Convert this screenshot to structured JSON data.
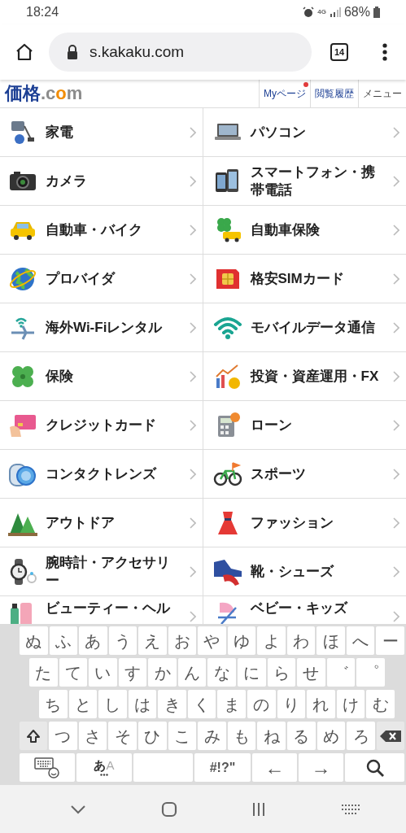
{
  "status_bar": {
    "time": "18:24",
    "network": "4G",
    "battery": "68%"
  },
  "browser": {
    "url": "s.kakaku.com",
    "tab_count": "14"
  },
  "site_header": {
    "logo": [
      {
        "text": "価格",
        "color": "#1c3f94"
      },
      {
        "text": ".c",
        "color": "#8c8c8c"
      },
      {
        "text": "o",
        "color": "#f28c00"
      },
      {
        "text": "m",
        "color": "#8c8c8c"
      }
    ],
    "links": [
      {
        "label": "Myページ",
        "badge": true
      },
      {
        "label": "閲覧履歴",
        "badge": false
      },
      {
        "label": "メニュー",
        "badge": false
      }
    ]
  },
  "category_rows": [
    [
      {
        "label": "家電"
      },
      {
        "label": "パソコン"
      }
    ],
    [
      {
        "label": "カメラ"
      },
      {
        "label": "スマートフォン・携帯電話"
      }
    ],
    [
      {
        "label": "自動車・バイク"
      },
      {
        "label": "自動車保険"
      }
    ],
    [
      {
        "label": "プロバイダ"
      },
      {
        "label": "格安SIMカード"
      }
    ],
    [
      {
        "label": "海外Wi-Fiレンタル"
      },
      {
        "label": "モバイルデータ通信"
      }
    ],
    [
      {
        "label": "保険"
      },
      {
        "label": "投資・資産運用・FX"
      }
    ],
    [
      {
        "label": "クレジットカード"
      },
      {
        "label": "ローン"
      }
    ],
    [
      {
        "label": "コンタクトレンズ"
      },
      {
        "label": "スポーツ"
      }
    ],
    [
      {
        "label": "アウトドア"
      },
      {
        "label": "ファッション"
      }
    ],
    [
      {
        "label": "腕時計・アクセサリー"
      },
      {
        "label": "靴・シューズ"
      }
    ],
    [
      {
        "label": "ビューティー・ヘル"
      },
      {
        "label": "ベビー・キッズ"
      }
    ]
  ],
  "keyboard": {
    "rows": [
      [
        {
          "kind": "char",
          "label": "ぬ"
        },
        {
          "kind": "char",
          "label": "ふ"
        },
        {
          "kind": "char",
          "label": "あ"
        },
        {
          "kind": "char",
          "label": "う"
        },
        {
          "kind": "char",
          "label": "え"
        },
        {
          "kind": "char",
          "label": "お"
        },
        {
          "kind": "char",
          "label": "や"
        },
        {
          "kind": "char",
          "label": "ゆ"
        },
        {
          "kind": "char",
          "label": "よ"
        },
        {
          "kind": "char",
          "label": "わ"
        },
        {
          "kind": "char",
          "label": "ほ"
        },
        {
          "kind": "char",
          "label": "へ"
        },
        {
          "kind": "char",
          "label": "ー"
        }
      ],
      [
        {
          "kind": "char",
          "label": "た"
        },
        {
          "kind": "char",
          "label": "て"
        },
        {
          "kind": "char",
          "label": "い"
        },
        {
          "kind": "char",
          "label": "す"
        },
        {
          "kind": "char",
          "label": "か"
        },
        {
          "kind": "char",
          "label": "ん"
        },
        {
          "kind": "char",
          "label": "な"
        },
        {
          "kind": "char",
          "label": "に"
        },
        {
          "kind": "char",
          "label": "ら"
        },
        {
          "kind": "char",
          "label": "せ"
        },
        {
          "kind": "char",
          "label": "゛"
        },
        {
          "kind": "char",
          "label": "゜"
        }
      ],
      [
        {
          "kind": "char",
          "label": "ち"
        },
        {
          "kind": "char",
          "label": "と"
        },
        {
          "kind": "char",
          "label": "し"
        },
        {
          "kind": "char",
          "label": "は"
        },
        {
          "kind": "char",
          "label": "き"
        },
        {
          "kind": "char",
          "label": "く"
        },
        {
          "kind": "char",
          "label": "ま"
        },
        {
          "kind": "char",
          "label": "の"
        },
        {
          "kind": "char",
          "label": "り"
        },
        {
          "kind": "char",
          "label": "れ"
        },
        {
          "kind": "char",
          "label": "け"
        },
        {
          "kind": "char",
          "label": "む"
        }
      ],
      [
        {
          "kind": "shift"
        },
        {
          "kind": "char",
          "label": "つ"
        },
        {
          "kind": "char",
          "label": "さ"
        },
        {
          "kind": "char",
          "label": "そ"
        },
        {
          "kind": "char",
          "label": "ひ"
        },
        {
          "kind": "char",
          "label": "こ"
        },
        {
          "kind": "char",
          "label": "み"
        },
        {
          "kind": "char",
          "label": "も"
        },
        {
          "kind": "char",
          "label": "ね"
        },
        {
          "kind": "char",
          "label": "る"
        },
        {
          "kind": "char",
          "label": "め"
        },
        {
          "kind": "char",
          "label": "ろ"
        },
        {
          "kind": "backspace"
        }
      ]
    ],
    "function_keys": [
      {
        "kind": "emoji"
      },
      {
        "kind": "mode",
        "label": "あ",
        "sub": "A"
      },
      {
        "kind": "space"
      },
      {
        "kind": "symbol",
        "label": "#!?\""
      },
      {
        "kind": "arrow",
        "label": "←"
      },
      {
        "kind": "arrow",
        "label": "→"
      },
      {
        "kind": "search"
      }
    ]
  }
}
